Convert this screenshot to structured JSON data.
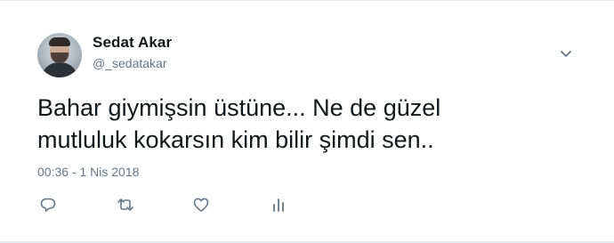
{
  "tweet": {
    "author_name": "Sedat Akar",
    "author_handle": "@_sedatakar",
    "text_lines": [
      "Bahar giymişsin üstüne... Ne de güzel",
      "mutluluk kokarsın kim bilir şimdi sen.."
    ],
    "timestamp": "00:36 - 1 Nis 2018"
  },
  "actions": [
    "reply-icon",
    "retweet-icon",
    "like-icon",
    "analytics-icon"
  ],
  "colors": {
    "text": "#14171a",
    "secondary": "#657786",
    "icon": "#657786",
    "border": "#e6ecf0"
  }
}
